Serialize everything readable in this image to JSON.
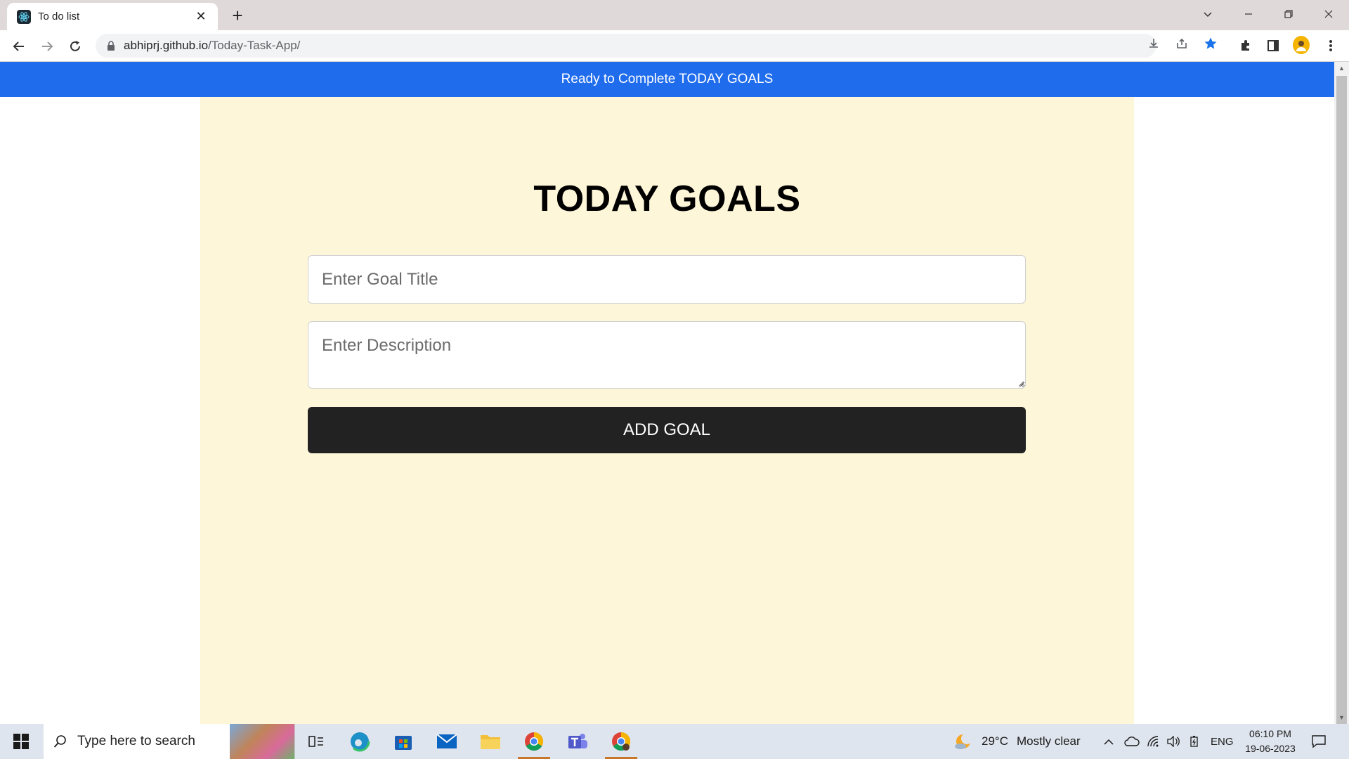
{
  "browser": {
    "tab_title": "To do list",
    "url_host": "abhiprj.github.io",
    "url_path": "/Today-Task-App/",
    "new_tab_label": "+"
  },
  "page": {
    "banner_text": "Ready to Complete TODAY GOALS",
    "heading": "TODAY GOALS",
    "title_placeholder": "Enter Goal Title",
    "description_placeholder": "Enter Description",
    "add_button_label": "ADD GOAL"
  },
  "taskbar": {
    "search_placeholder": "Type here to search",
    "weather_temp": "29°C",
    "weather_text": "Mostly clear",
    "language": "ENG",
    "time": "06:10 PM",
    "date": "19-06-2023"
  },
  "colors": {
    "banner": "#1f6ced",
    "panel": "#fef6d9",
    "button": "#222222"
  }
}
